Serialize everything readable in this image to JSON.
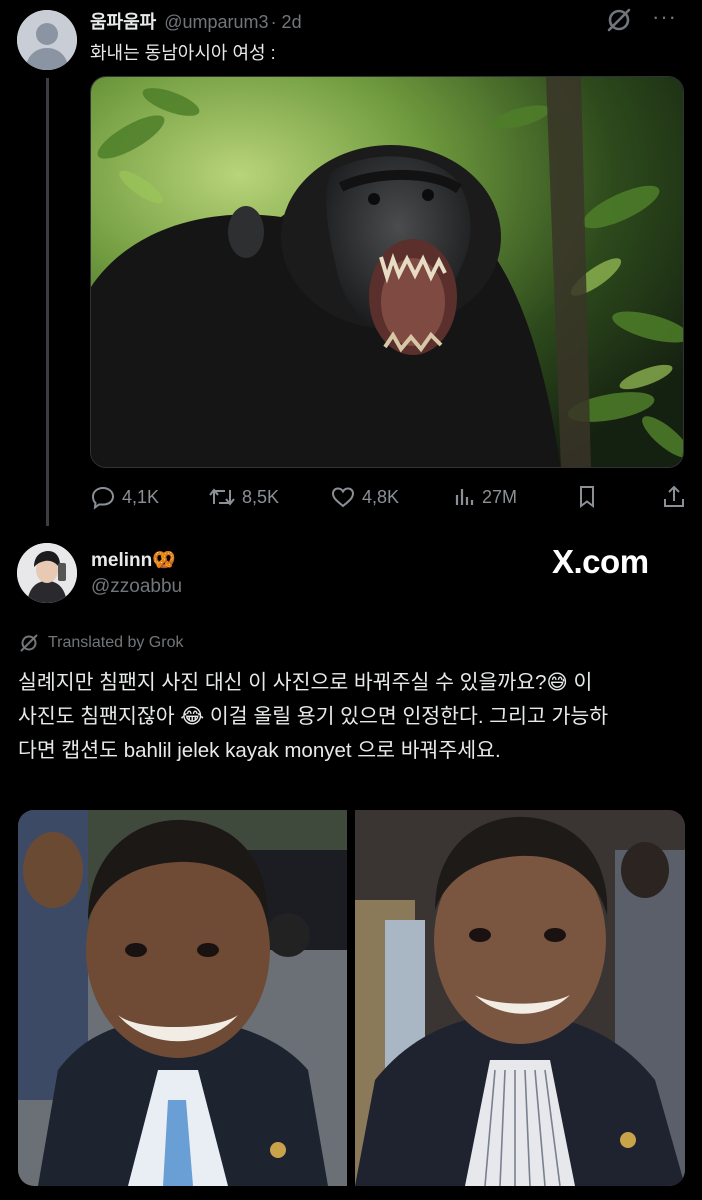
{
  "tweet1": {
    "display_name": "움파움파",
    "handle": "@umparum3",
    "time": "· 2d",
    "text": "화내는 동남아시아 여성 :",
    "media": {
      "icon": "chimpanzee-photo"
    },
    "grok_icon": "grok-slash-icon",
    "more_icon": "more-icon",
    "more_glyph": "···",
    "stats": {
      "replies": "4,1K",
      "reposts": "8,5K",
      "likes": "4,8K",
      "views": "27M"
    }
  },
  "tweet2": {
    "display_name": "melinn🥨",
    "handle": "@zzoabbu",
    "watermark": "X.com",
    "translated_label": "Translated by Grok",
    "body_lines": [
      "실례지만 침팬지 사진 대신 이 사진으로 바꿔주실 수 있을까요?😅  이",
      "사진도 침팬지잖아 😂  이걸 올릴 용기 있으면 인정한다. 그리고 가능하",
      "다면 캡션도 bahlil jelek kayak monyet 으로 바꿔주세요."
    ],
    "photos": [
      "man-in-suit-photo-left",
      "man-in-suit-photo-right"
    ]
  },
  "colors": {
    "background": "#000000",
    "text": "#e7e9ea",
    "muted": "#71767b",
    "thread_line": "#3a3d41"
  }
}
